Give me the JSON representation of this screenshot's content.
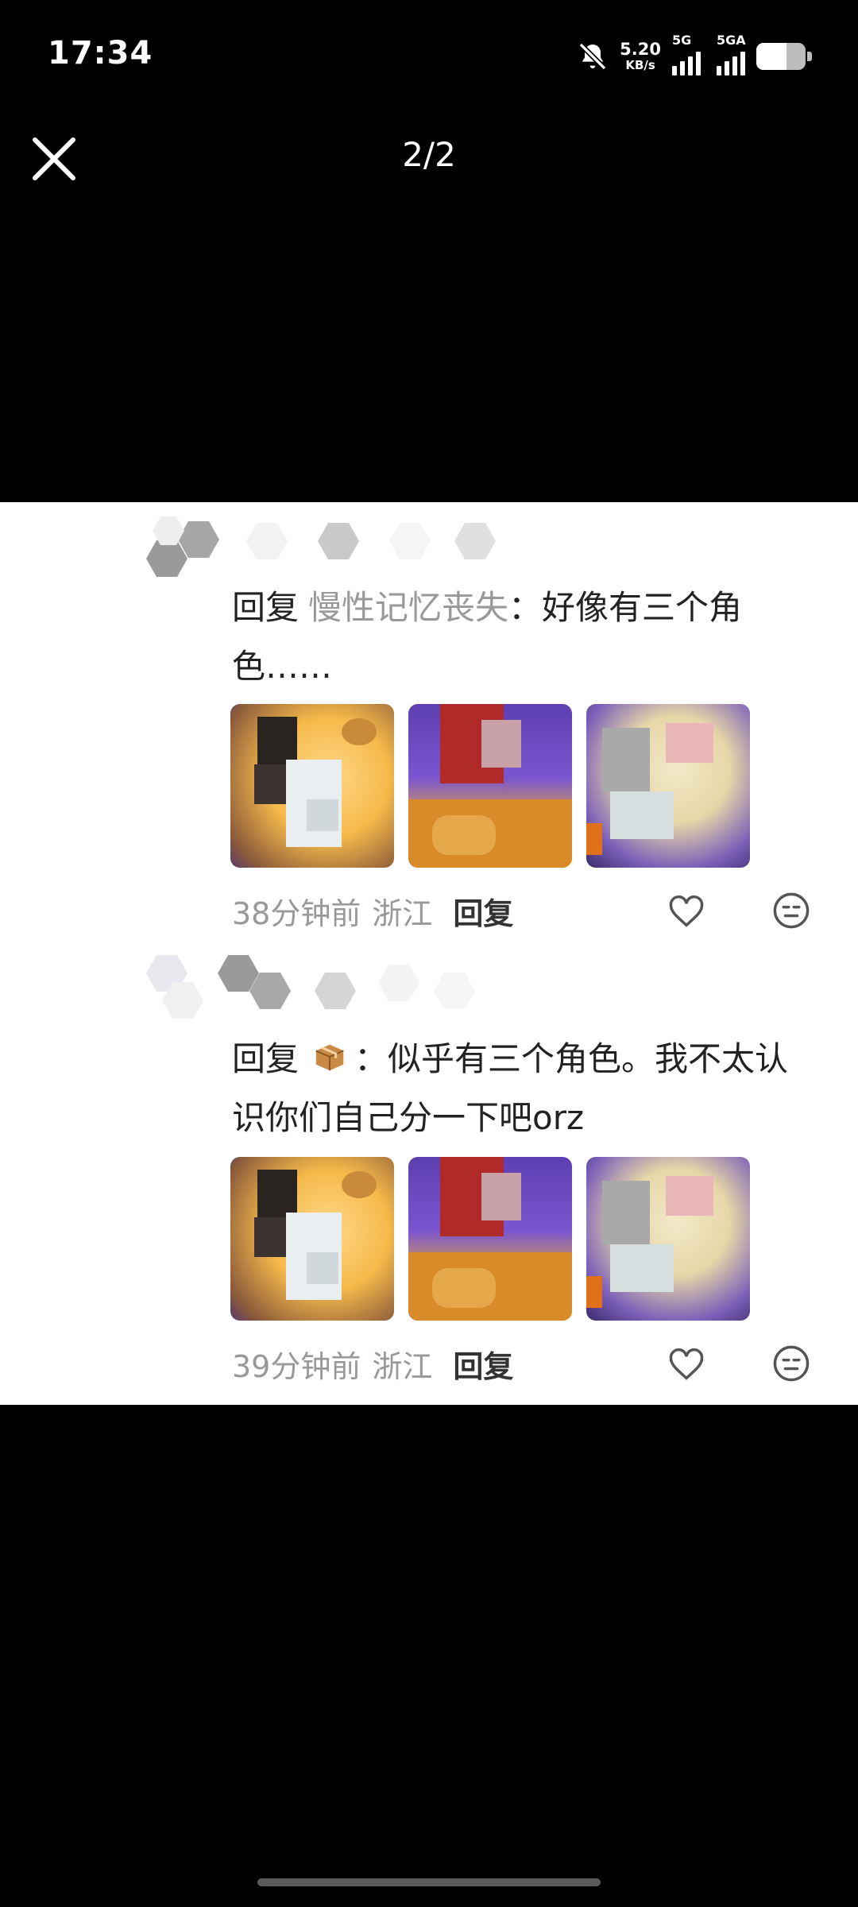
{
  "status_bar": {
    "time": "17:34",
    "net_speed_value": "5.20",
    "net_speed_unit": "KB/s",
    "sim1_label": "5G",
    "sim2_label": "5GA",
    "battery_level": 0.62
  },
  "viewer": {
    "counter": "2/2"
  },
  "comments": [
    {
      "reply_label": "回复",
      "reply_to": "慢性记忆丧失",
      "text": "：好像有三个角色……",
      "time": "38分钟前",
      "location": "浙江",
      "reply_button": "回复"
    },
    {
      "reply_label": "回复",
      "reply_to": "",
      "text": "：似乎有三个角色。我不太认识你们自己分一下吧orz",
      "time": "39分钟前",
      "location": "浙江",
      "reply_button": "回复"
    }
  ],
  "icons": [
    "close-icon",
    "heart-icon",
    "emoji-icon",
    "mute-bell-icon",
    "battery-icon",
    "box-emoji-icon"
  ],
  "colors": {
    "background": "#000000",
    "panel": "#ffffff",
    "muted_text": "#999999",
    "main_text": "#222222"
  }
}
